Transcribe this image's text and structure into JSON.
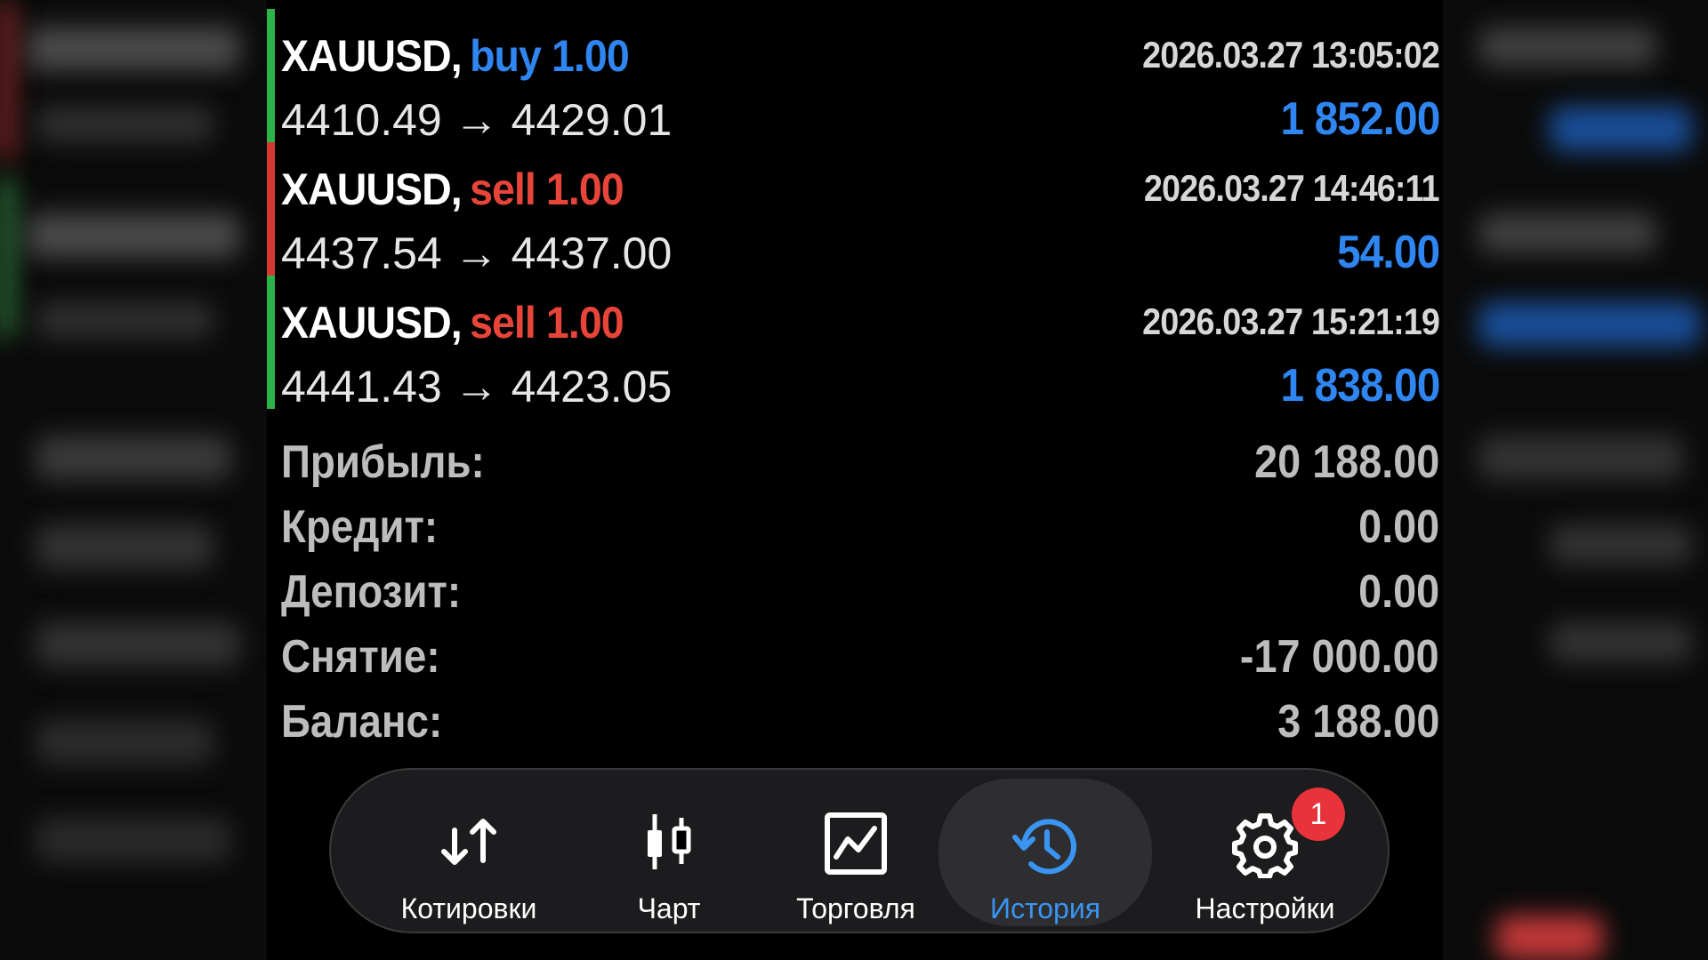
{
  "trades": [
    {
      "symbol": "XAUUSD,",
      "direction": "buy",
      "volume": "1.00",
      "time": "2026.03.27 13:05:02",
      "open_price": "4410.49",
      "close_price": "4429.01",
      "profit": "1 852.00",
      "color": "#2f86f0",
      "bar_color": "#2db34a"
    },
    {
      "symbol": "XAUUSD,",
      "direction": "sell",
      "volume": "1.00",
      "time": "2026.03.27 14:46:11",
      "open_price": "4437.54",
      "close_price": "4437.00",
      "profit": "54.00",
      "color": "#e8453a",
      "bar_color": "#d03a33"
    },
    {
      "symbol": "XAUUSD,",
      "direction": "sell",
      "volume": "1.00",
      "time": "2026.03.27 15:21:19",
      "open_price": "4441.43",
      "close_price": "4423.05",
      "profit": "1 838.00",
      "color": "#e8453a",
      "bar_color": "#2db34a"
    }
  ],
  "arrow": "→",
  "summary": [
    {
      "label": "Прибыль:",
      "value": "20 188.00"
    },
    {
      "label": "Кредит:",
      "value": "0.00"
    },
    {
      "label": "Депозит:",
      "value": "0.00"
    },
    {
      "label": "Снятие:",
      "value": "-17 000.00"
    },
    {
      "label": "Баланс:",
      "value": "3 188.00"
    }
  ],
  "nav": {
    "items": [
      {
        "label": "Котировки",
        "icon": "quotes-arrows-icon"
      },
      {
        "label": "Чарт",
        "icon": "candlestick-chart-icon"
      },
      {
        "label": "Торговля",
        "icon": "trade-chart-icon"
      },
      {
        "label": "История",
        "icon": "history-clock-icon",
        "active": true
      },
      {
        "label": "Настройки",
        "icon": "settings-gear-icon",
        "badge": "1"
      }
    ]
  },
  "colors": {
    "accent": "#3a95f2",
    "profit": "#2f86f0",
    "sell": "#e8453a",
    "buy_bar": "#2db34a",
    "sell_bar": "#d03a33",
    "badge": "#e8333b"
  }
}
